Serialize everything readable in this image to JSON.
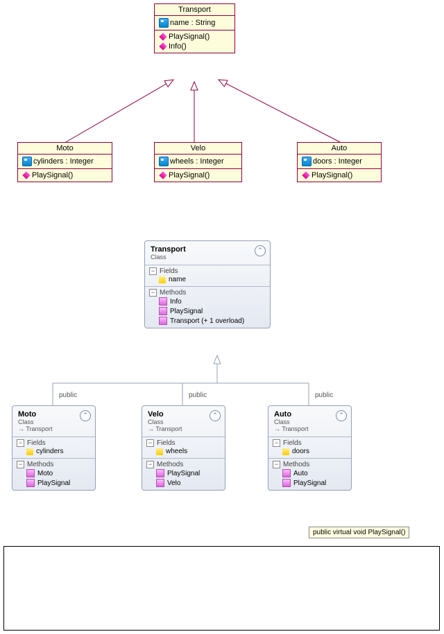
{
  "uml": {
    "transport": {
      "name": "Transport",
      "attr": "name : String",
      "m1": "PlaySignal()",
      "m2": "Info()"
    },
    "moto": {
      "name": "Moto",
      "attr": "cylinders : Integer",
      "m": "PlaySignal()"
    },
    "velo": {
      "name": "Velo",
      "attr": "wheels : Integer",
      "m": "PlaySignal()"
    },
    "auto": {
      "name": "Auto",
      "attr": "doors : Integer",
      "m": "PlaySignal()"
    }
  },
  "vs": {
    "classLabel": "Class",
    "inherit": "Transport",
    "fields": "Fields",
    "methods": "Methods",
    "transport": {
      "name": "Transport",
      "f": "name",
      "m1": "Info",
      "m2": "PlaySignal",
      "m3": "Transport (+ 1 overload)"
    },
    "moto": {
      "name": "Moto",
      "f": "cylinders",
      "m1": "Moto",
      "m2": "PlaySignal"
    },
    "velo": {
      "name": "Velo",
      "f": "wheels",
      "m1": "PlaySignal",
      "m2": "Velo"
    },
    "auto": {
      "name": "Auto",
      "f": "doors",
      "m1": "Auto",
      "m2": "PlaySignal"
    }
  },
  "edge": "public",
  "tooltip": "public virtual void PlaySignal()"
}
